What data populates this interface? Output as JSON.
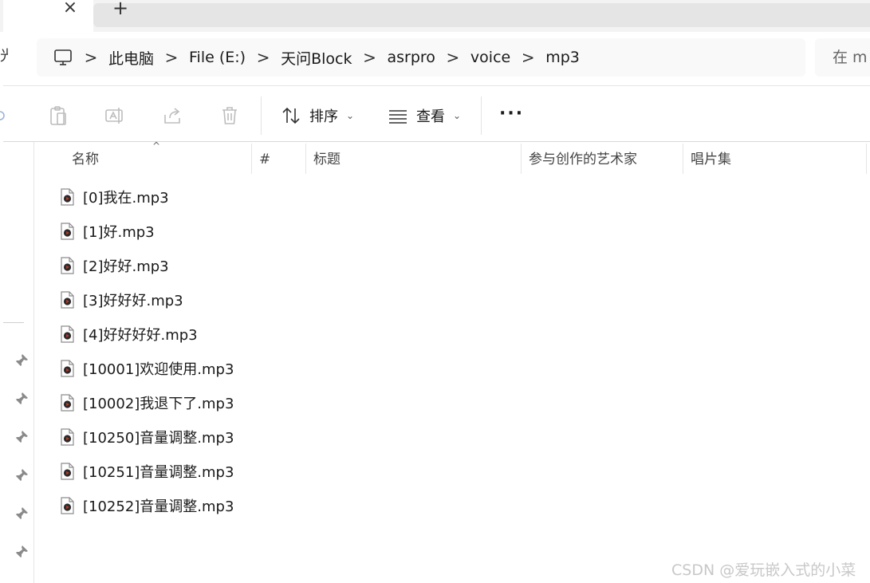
{
  "tabs": {
    "close_glyph": "×",
    "new_glyph": "+"
  },
  "nav_cut_glyph": "光",
  "breadcrumb": [
    "此电脑",
    "File (E:)",
    "天问Block",
    "asrpro",
    "voice",
    "mp3"
  ],
  "breadcrumb_separator": ">",
  "search": {
    "placeholder": "在 m"
  },
  "toolbar": {
    "sort_label": "排序",
    "view_label": "查看",
    "caret": "⌄",
    "more_label": "···"
  },
  "columns": {
    "name": "名称",
    "number": "#",
    "title": "标题",
    "artist": "参与创作的艺术家",
    "album": "唱片集"
  },
  "sort_indicator": "^",
  "files": [
    "[0]我在.mp3",
    "[1]好.mp3",
    "[2]好好.mp3",
    "[3]好好好.mp3",
    "[4]好好好好.mp3",
    "[10001]欢迎使用.mp3",
    "[10002]我退下了.mp3",
    "[10250]音量调整.mp3",
    "[10251]音量调整.mp3",
    "[10252]音量调整.mp3"
  ],
  "watermark": "CSDN @爱玩嵌入式的小菜",
  "colors": {
    "file_icon_accent": "#c0392b",
    "background": "#ffffff",
    "tab_strip": "#f3f3f3"
  }
}
